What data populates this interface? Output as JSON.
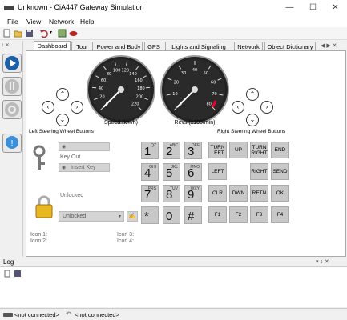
{
  "window": {
    "title": "Unknown - CiA447 Gateway Simulation"
  },
  "menu": [
    "File",
    "View",
    "Network",
    "Help"
  ],
  "tabs": [
    {
      "label": "Dashboard",
      "active": true
    },
    {
      "label": "Tour"
    },
    {
      "label": "Power and Body"
    },
    {
      "label": "GPS"
    },
    {
      "label": "Lights and Signaling"
    },
    {
      "label": "Network"
    },
    {
      "label": "Object Dictionary"
    }
  ],
  "gauges": {
    "speed": {
      "label": "Speed (km/h)",
      "ticks": [
        "0",
        "20",
        "40",
        "60",
        "80",
        "100",
        "120",
        "140",
        "160",
        "180",
        "200",
        "220"
      ],
      "value": 0
    },
    "revs": {
      "label": "Revs (x100/min)",
      "ticks": [
        "0",
        "10",
        "20",
        "30",
        "40",
        "50",
        "60",
        "70",
        "80"
      ],
      "value": 0
    }
  },
  "steering": {
    "left_label": "Left Steering Wheel Buttons",
    "right_label": "Right Steering Wheel Buttons"
  },
  "key_panel": {
    "key_out": "Key Out",
    "insert_key": "Insert Key",
    "unlocked_status": "Unlocked",
    "lock_select": "Unlocked"
  },
  "keypad": [
    {
      "main": "1",
      "sub": "QZ"
    },
    {
      "main": "2",
      "sub": "ABC"
    },
    {
      "main": "3",
      "sub": "DEF"
    },
    {
      "main": "4",
      "sub": "GHI"
    },
    {
      "main": "5",
      "sub": "JKL"
    },
    {
      "main": "6",
      "sub": "MNO"
    },
    {
      "main": "7",
      "sub": "PRS"
    },
    {
      "main": "8",
      "sub": "TUV"
    },
    {
      "main": "9",
      "sub": "WXY"
    },
    {
      "main": "*",
      "sub": ""
    },
    {
      "main": "0",
      "sub": ""
    },
    {
      "main": "#",
      "sub": ""
    }
  ],
  "function_keys": [
    "TURN LEFT",
    "UP",
    "TURN RIGHT",
    "END",
    "LEFT",
    "",
    "RIGHT",
    "SEND",
    "CLR",
    "DWN",
    "RETN",
    "OK",
    "F1",
    "F2",
    "F3",
    "F4"
  ],
  "icons_labels": [
    "Icon 1:",
    "Icon 2:",
    "Icon 3:",
    "Icon 4:"
  ],
  "log": {
    "title": "Log"
  },
  "status": {
    "left": "<not connected>",
    "right": "<not connected>"
  }
}
